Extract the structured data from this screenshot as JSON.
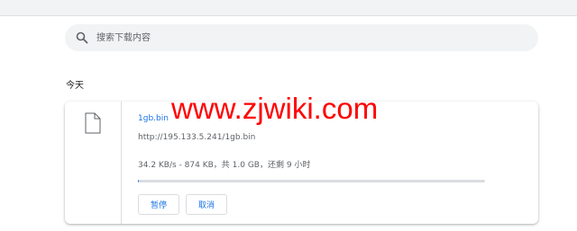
{
  "search": {
    "placeholder": "搜索下载内容",
    "value": ""
  },
  "section": {
    "title": "今天"
  },
  "download": {
    "file_name": "1gb.bin",
    "url": "http://195.133.5.241/1gb.bin",
    "status": "34.2 KB/s - 874 KB，共 1.0 GB，还剩 9 小时",
    "progress_fraction": 0.0009,
    "pause_label": "暂停",
    "cancel_label": "取消"
  },
  "watermark": {
    "text": "www.zjwiki.com"
  },
  "colors": {
    "accent": "#1a73e8",
    "watermark": "#ff0000"
  },
  "icons": {
    "search": "search-icon",
    "file": "file-icon"
  }
}
